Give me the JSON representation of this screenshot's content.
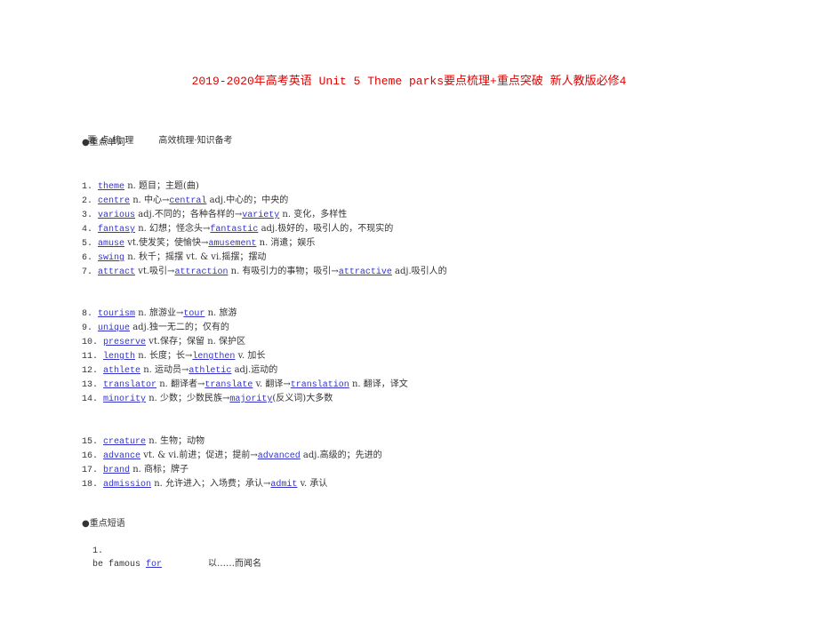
{
  "document": {
    "title": "2019-2020年高考英语 Unit 5  Theme parks要点梳理+重点突破 新人教版必修4",
    "colors": {
      "title": "#e00000",
      "link": "#3333cc",
      "text": "#333333"
    },
    "section_heading": "要点梳理",
    "section_subheading": "高效梳理·知识备考",
    "vocab_heading": "●重点单词",
    "vocab": [
      {
        "num": "1.",
        "parts": [
          {
            "link": "theme"
          },
          {
            "text": " n. 题目；主题(曲)"
          }
        ]
      },
      {
        "num": "2.",
        "parts": [
          {
            "link": "centre"
          },
          {
            "text": " n. 中心→"
          },
          {
            "link": "central"
          },
          {
            "text": " adj.中心的；中央的"
          }
        ]
      },
      {
        "num": "3.",
        "parts": [
          {
            "link": "various"
          },
          {
            "text": " adj.不同的；各种各样的→"
          },
          {
            "link": "variety"
          },
          {
            "text": " n. 变化，多样性"
          }
        ]
      },
      {
        "num": "4.",
        "parts": [
          {
            "link": "fantasy"
          },
          {
            "text": " n. 幻想；怪念头→"
          },
          {
            "link": "fantastic"
          },
          {
            "text": " adj.极好的，吸引人的，不现实的"
          }
        ]
      },
      {
        "num": "5.",
        "parts": [
          {
            "link": "amuse"
          },
          {
            "text": " vt.使发笑；使愉快→"
          },
          {
            "link": "amusement"
          },
          {
            "text": " n. 消遣；娱乐"
          }
        ]
      },
      {
        "num": "6.",
        "parts": [
          {
            "link": "swing"
          },
          {
            "text": " n. 秋千；摇摆 vt. & vi.摇摆；摆动"
          }
        ]
      },
      {
        "num": "7.",
        "parts": [
          {
            "link": "attract"
          },
          {
            "text": " vt.吸引→"
          },
          {
            "link": "attraction"
          },
          {
            "text": " n. 有吸引力的事物；吸引→"
          },
          {
            "link": "attractive"
          },
          {
            "text": " adj.吸引人的"
          }
        ]
      },
      {
        "num": "8.",
        "parts": [
          {
            "link": "tourism"
          },
          {
            "text": " n. 旅游业→"
          },
          {
            "link": "tour"
          },
          {
            "text": " n. 旅游"
          }
        ]
      },
      {
        "num": "9.",
        "parts": [
          {
            "link": "unique"
          },
          {
            "text": " adj.独一无二的；仅有的"
          }
        ]
      },
      {
        "num": "10.",
        "parts": [
          {
            "link": "preserve"
          },
          {
            "text": " vt.保存；保留 n. 保护区"
          }
        ]
      },
      {
        "num": "11.",
        "parts": [
          {
            "link": "length"
          },
          {
            "text": " n. 长度；长→"
          },
          {
            "link": "lengthen"
          },
          {
            "text": " v. 加长"
          }
        ]
      },
      {
        "num": "12.",
        "parts": [
          {
            "link": "athlete"
          },
          {
            "text": " n. 运动员→"
          },
          {
            "link": "athletic"
          },
          {
            "text": " adj.运动的"
          }
        ]
      },
      {
        "num": "13.",
        "parts": [
          {
            "link": "translator"
          },
          {
            "text": " n. 翻译者→"
          },
          {
            "link": "translate"
          },
          {
            "text": " v. 翻译→"
          },
          {
            "link": "translation"
          },
          {
            "text": " n. 翻译，译文"
          }
        ]
      },
      {
        "num": "14.",
        "parts": [
          {
            "link": "minority"
          },
          {
            "text": " n. 少数；少数民族→"
          },
          {
            "link": "majority"
          },
          {
            "text": "(反义词)大多数"
          }
        ]
      },
      {
        "num": "15.",
        "parts": [
          {
            "link": "creature"
          },
          {
            "text": " n. 生物；动物"
          }
        ]
      },
      {
        "num": "16.",
        "parts": [
          {
            "link": "advance"
          },
          {
            "text": " vt. & vi.前进；促进；提前→"
          },
          {
            "link": "advanced"
          },
          {
            "text": " adj.高级的；先进的"
          }
        ]
      },
      {
        "num": "17.",
        "parts": [
          {
            "link": "brand"
          },
          {
            "text": " n. 商标；牌子"
          }
        ]
      },
      {
        "num": "18.",
        "parts": [
          {
            "link": "admission"
          },
          {
            "text": " n. 允许进入；入场费；承认→"
          },
          {
            "link": "admit"
          },
          {
            "text": " v. 承认"
          }
        ]
      }
    ],
    "phrase_heading": "●重点短语",
    "phrases": [
      {
        "num": "1.",
        "prefix": "be famous ",
        "link": "for",
        "meaning": "以……而闻名"
      }
    ]
  }
}
